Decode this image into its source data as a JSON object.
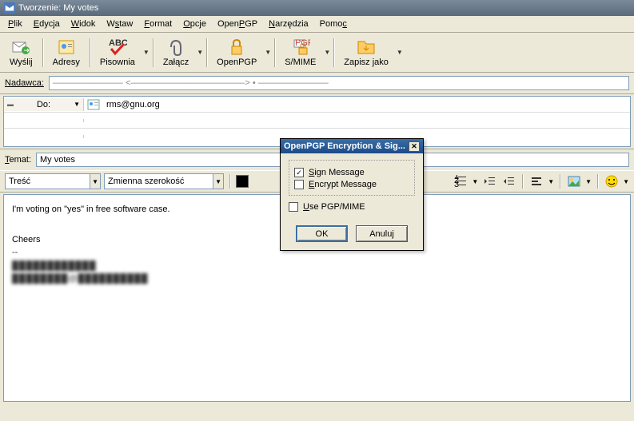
{
  "window": {
    "title": "Tworzenie: My votes"
  },
  "menu": [
    "Plik",
    "Edycja",
    "Widok",
    "Wstaw",
    "Format",
    "Opcje",
    "OpenPGP",
    "Narzędzia",
    "Pomoc"
  ],
  "toolbar": {
    "send": "Wyślij",
    "contacts": "Adresy",
    "spell": "Pisownia",
    "attach": "Załącz",
    "openpgp": "OpenPGP",
    "smime": "S/MIME",
    "saveas": "Zapisz jako"
  },
  "sender": {
    "label": "Nadawca:",
    "value": "————————  <—————————————>   •  ————————"
  },
  "recipient": {
    "type_label": "Do:",
    "value": "rms@gnu.org"
  },
  "subject": {
    "label": "Temat:",
    "value": "My votes"
  },
  "format": {
    "style": "Treść",
    "font": "Zmienna szerokość"
  },
  "body": {
    "line1": "I'm voting on \"yes\" in free software case.",
    "line2": "Cheers",
    "line3": "--",
    "sig1": "████████████",
    "sig2": "████████@██████████"
  },
  "dialog": {
    "title": "OpenPGP Encryption & Sig...",
    "sign": "Sign Message",
    "sign_checked": true,
    "encrypt": "Encrypt Message",
    "encrypt_checked": false,
    "pgpmime": "Use PGP/MIME",
    "pgpmime_checked": false,
    "ok": "OK",
    "cancel": "Anuluj"
  }
}
